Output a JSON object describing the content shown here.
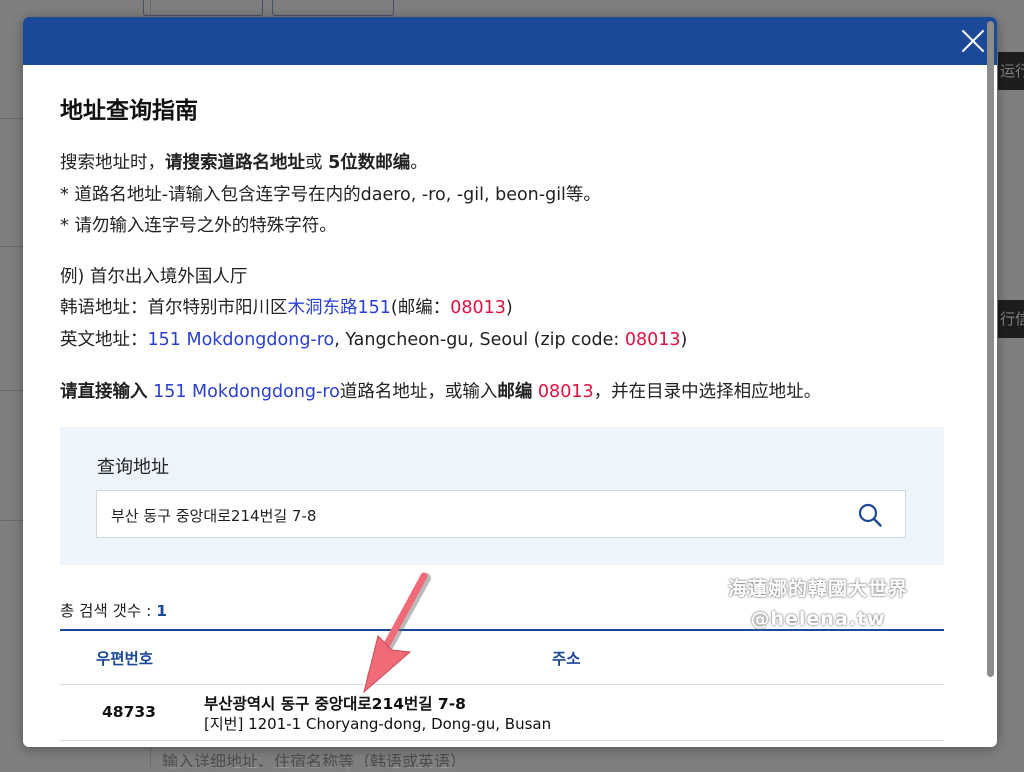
{
  "background": {
    "side_tab_1": "运行",
    "side_tab_2": "行信",
    "input_hint": "输入详细地址、住宿名称等（韩语或英语）"
  },
  "modal": {
    "title": "地址查询指南",
    "intro": {
      "prefix": "搜索地址时，",
      "bold1": "请搜索道路名地址",
      "mid": "或 ",
      "bold2": "5位数邮编",
      "suffix": "。"
    },
    "note1": "* 道路名地址-请输入包含连字号在内的daero, -ro, -gil, beon-gil等。",
    "note2": "* 请勿输入连字号之外的特殊字符。",
    "example": {
      "heading": "例) 首尔出入境外国人厅",
      "korean_label": "韩语地址：首尔特别市阳川区",
      "korean_road": "木洞东路151",
      "korean_zip_prefix": "(邮编：",
      "korean_zip": "08013",
      "korean_zip_suffix": ")",
      "english_label": "英文地址：",
      "english_road": "151 Mokdongdong-ro",
      "english_rest": ", Yangcheon-gu, Seoul (zip code: ",
      "english_zip": "08013",
      "english_suffix": ")"
    },
    "instruction": {
      "bold1": "请直接输入",
      "space": " ",
      "road": "151 Mokdongdong-ro",
      "mid": "道路名地址，或输入",
      "bold2": "邮编",
      "zip": " 08013",
      "suffix": "，并在目录中选择相应地址。"
    },
    "search": {
      "label": "查询地址",
      "value": "부산 동구 중앙대로214번길 7-8"
    },
    "results": {
      "count_label": "총 검색 갯수 : ",
      "count": "1",
      "columns": [
        "우편번호",
        "주소"
      ],
      "rows": [
        {
          "zip": "48733",
          "road_address": "부산광역시 동구 중앙대로214번길 7-8",
          "jibun_address": "[지번] 1201-1 Choryang-dong, Dong-gu, Busan"
        }
      ]
    }
  },
  "watermark": {
    "line1": "海蓮娜的韓國大世界",
    "line2": "@helena.tw"
  },
  "colors": {
    "header": "#1c4898",
    "link_blue": "#2a3fd6",
    "zip_red": "#e0103e",
    "search_panel_bg": "#eef4fc",
    "annotation_arrow": "#f06b77"
  }
}
